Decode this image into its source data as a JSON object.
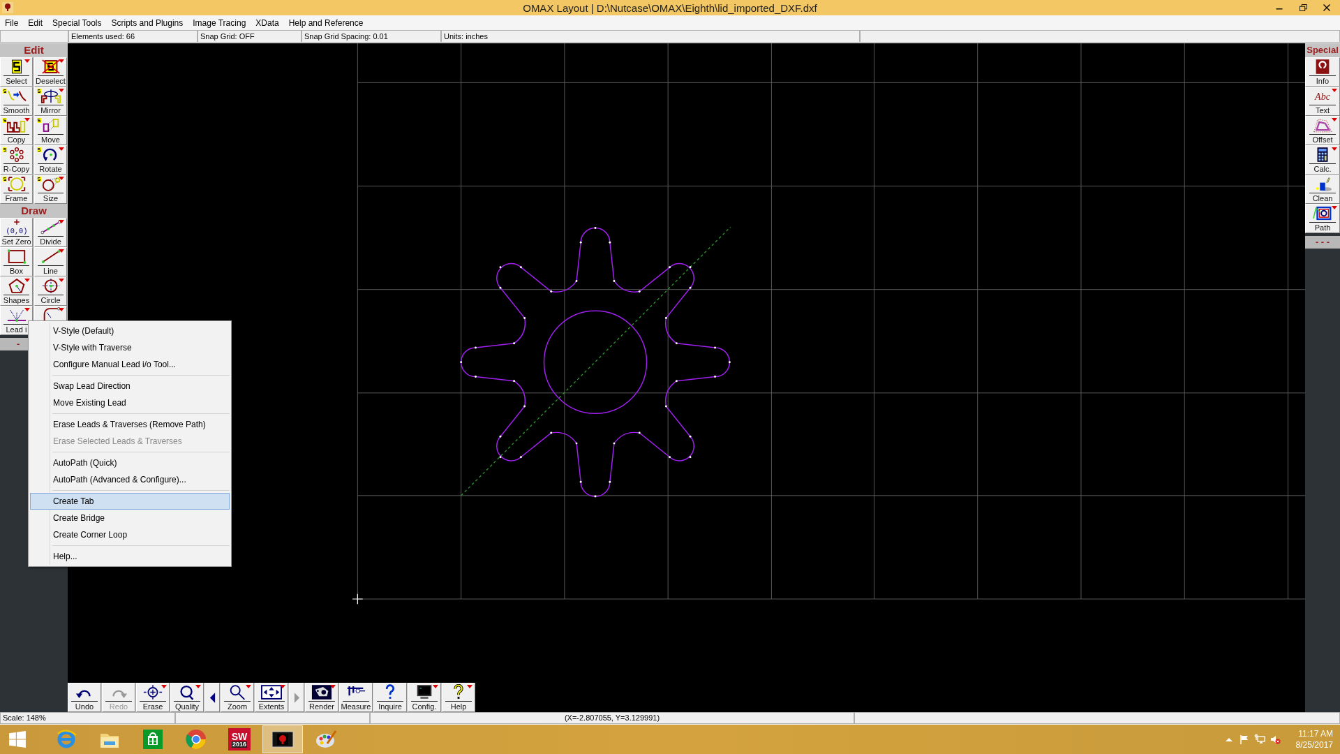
{
  "window": {
    "title": "OMAX Layout | D:\\Nutcase\\OMAX\\Eighth\\lid_imported_DXF.dxf"
  },
  "menu_bar": [
    "File",
    "Edit",
    "Special Tools",
    "Scripts and Plugins",
    "Image Tracing",
    "XData",
    "Help and Reference"
  ],
  "info_bar": [
    "Elements used: 66",
    "Snap Grid: OFF",
    "Snap Grid Spacing: 0.01",
    "Units: inches"
  ],
  "edit_panel": {
    "title": "Edit",
    "tools": [
      {
        "label": "Select",
        "dropdown": true,
        "selection_badge": false
      },
      {
        "label": "Deselect",
        "dropdown": true,
        "selection_badge": false
      },
      {
        "label": "Smooth",
        "dropdown": false,
        "selection_badge": true
      },
      {
        "label": "Mirror",
        "dropdown": true,
        "selection_badge": true
      },
      {
        "label": "Copy",
        "dropdown": true,
        "selection_badge": true
      },
      {
        "label": "Move",
        "dropdown": false,
        "selection_badge": true
      },
      {
        "label": "R-Copy",
        "dropdown": false,
        "selection_badge": true
      },
      {
        "label": "Rotate",
        "dropdown": true,
        "selection_badge": true
      },
      {
        "label": "Frame",
        "dropdown": false,
        "selection_badge": true
      },
      {
        "label": "Size",
        "dropdown": true,
        "selection_badge": true
      }
    ]
  },
  "draw_panel": {
    "title": "Draw",
    "tools": [
      {
        "label": "Set Zero",
        "icon_text": "(0,0)",
        "dropdown": false,
        "selection_badge": false
      },
      {
        "label": "Divide",
        "dropdown": true,
        "selection_badge": false
      },
      {
        "label": "Box",
        "dropdown": false,
        "selection_badge": false
      },
      {
        "label": "Line",
        "dropdown": true,
        "selection_badge": false
      },
      {
        "label": "Shapes",
        "dropdown": true,
        "selection_badge": false
      },
      {
        "label": "Circle",
        "dropdown": true,
        "selection_badge": false
      },
      {
        "label": "Lead i",
        "dropdown": true,
        "selection_badge": false
      },
      {
        "dropdown": true,
        "selection_badge": false
      }
    ],
    "more": "-"
  },
  "special_panel": {
    "title": "Special",
    "tools": [
      {
        "label": "Info",
        "dropdown": false
      },
      {
        "label": "Text",
        "icon_text": "Abc",
        "dropdown": true
      },
      {
        "label": "Offset",
        "dropdown": true
      },
      {
        "label": "Calc.",
        "dropdown": true
      },
      {
        "label": "Clean",
        "dropdown": false
      },
      {
        "label": "Path",
        "dropdown": true
      }
    ],
    "more": "- - -"
  },
  "context_menu": {
    "groups": [
      [
        {
          "label": "V-Style (Default)",
          "selected": false,
          "disabled": false
        },
        {
          "label": "V-Style with Traverse",
          "selected": false,
          "disabled": false
        },
        {
          "label": "Configure Manual Lead i/o Tool...",
          "selected": false,
          "disabled": false
        }
      ],
      [
        {
          "label": "Swap Lead Direction",
          "selected": false,
          "disabled": false
        },
        {
          "label": "Move Existing Lead",
          "selected": false,
          "disabled": false
        }
      ],
      [
        {
          "label": "Erase Leads & Traverses (Remove Path)",
          "selected": false,
          "disabled": false
        },
        {
          "label": "Erase Selected Leads & Traverses",
          "selected": false,
          "disabled": true
        }
      ],
      [
        {
          "label": "AutoPath (Quick)",
          "selected": false,
          "disabled": false
        },
        {
          "label": "AutoPath (Advanced & Configure)...",
          "selected": false,
          "disabled": false
        }
      ],
      [
        {
          "label": "Create Tab",
          "selected": true,
          "disabled": false
        },
        {
          "label": "Create Bridge",
          "selected": false,
          "disabled": false
        },
        {
          "label": "Create Corner Loop",
          "selected": false,
          "disabled": false
        }
      ],
      [
        {
          "label": "Help...",
          "selected": false,
          "disabled": false
        }
      ]
    ]
  },
  "bottom_toolbar": [
    {
      "kind": "tool",
      "label": "Undo",
      "dropdown": false,
      "disabled": false
    },
    {
      "kind": "tool",
      "label": "Redo",
      "dropdown": false,
      "disabled": true
    },
    {
      "kind": "tool",
      "label": "Erase",
      "dropdown": true,
      "disabled": false
    },
    {
      "kind": "tool",
      "label": "Quality",
      "dropdown": true,
      "disabled": false
    },
    {
      "kind": "back",
      "disabled": false
    },
    {
      "kind": "tool",
      "label": "Zoom",
      "dropdown": true,
      "disabled": false
    },
    {
      "kind": "tool",
      "label": "Extents",
      "dropdown": true,
      "disabled": false
    },
    {
      "kind": "forward",
      "disabled": true
    },
    {
      "kind": "tool",
      "label": "Render",
      "dropdown": true,
      "disabled": false
    },
    {
      "kind": "tool",
      "label": "Measure",
      "dropdown": false,
      "disabled": false
    },
    {
      "kind": "tool",
      "label": "Inquire",
      "dropdown": false,
      "disabled": false
    },
    {
      "kind": "tool",
      "label": "Config.",
      "dropdown": true,
      "disabled": false
    },
    {
      "kind": "tool",
      "label": "Help",
      "dropdown": true,
      "disabled": false
    }
  ],
  "status_bar": {
    "scale": "Scale: 148%",
    "coordinates": "(X=-2.807055, Y=3.129991)"
  },
  "taskbar": {
    "apps": [
      {
        "active": false
      },
      {
        "active": false
      },
      {
        "active": false
      },
      {
        "active": false
      },
      {
        "active": false,
        "logo": "SW",
        "badge": "2016"
      },
      {
        "active": true
      },
      {
        "active": false
      }
    ],
    "time": "11:17 AM",
    "date": "8/25/2017"
  }
}
